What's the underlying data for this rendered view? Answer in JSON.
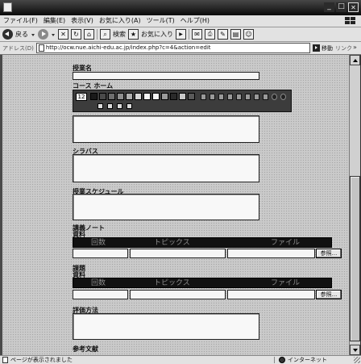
{
  "menu": {
    "items": [
      "ファイル(F)",
      "編集(E)",
      "表示(V)",
      "お気に入り(A)",
      "ツール(T)",
      "ヘルプ(H)"
    ]
  },
  "toolbar": {
    "back_label": "戻る",
    "search_label": "検索",
    "favorites_label": "お気に入り"
  },
  "address": {
    "label": "アドレス(D)",
    "url": "http://ocw.nue.aichi-edu.ac.jp/index.php?c=4&action=edit",
    "go_label": "移動",
    "links_label": "リンク"
  },
  "form": {
    "course_name": {
      "label": "授業名"
    },
    "course_home": {
      "label": "コース ホーム",
      "editor": {
        "font_size": "12",
        "swatches": [
          "#1a1a1a",
          "#4a4a4a",
          "#6e6e6e",
          "#8e8e8e",
          "#b0b0b0",
          "#d8d8d8",
          "#f4f4f4",
          "#f4f4f4",
          "#9a9a9a",
          "#2a2a2a",
          "#c8c8c8",
          "#5a5a5a"
        ]
      }
    },
    "syllabus": {
      "label": "シラバス"
    },
    "schedule": {
      "label": "授業スケジュール"
    },
    "lecture_notes": {
      "label": "講義ノート",
      "sublabel": "資料",
      "headers": [
        "回数",
        "トピックス",
        "ファイル"
      ],
      "browse_label": "参照..."
    },
    "assignments": {
      "label": "課題",
      "sublabel": "資料",
      "headers": [
        "回数",
        "トピックス",
        "ファイル"
      ],
      "browse_label": "参照..."
    },
    "evaluation": {
      "label": "評価方法"
    },
    "references": {
      "label": "参考文献"
    }
  },
  "status": {
    "message": "ページが表示されました",
    "zone": "インターネット"
  }
}
